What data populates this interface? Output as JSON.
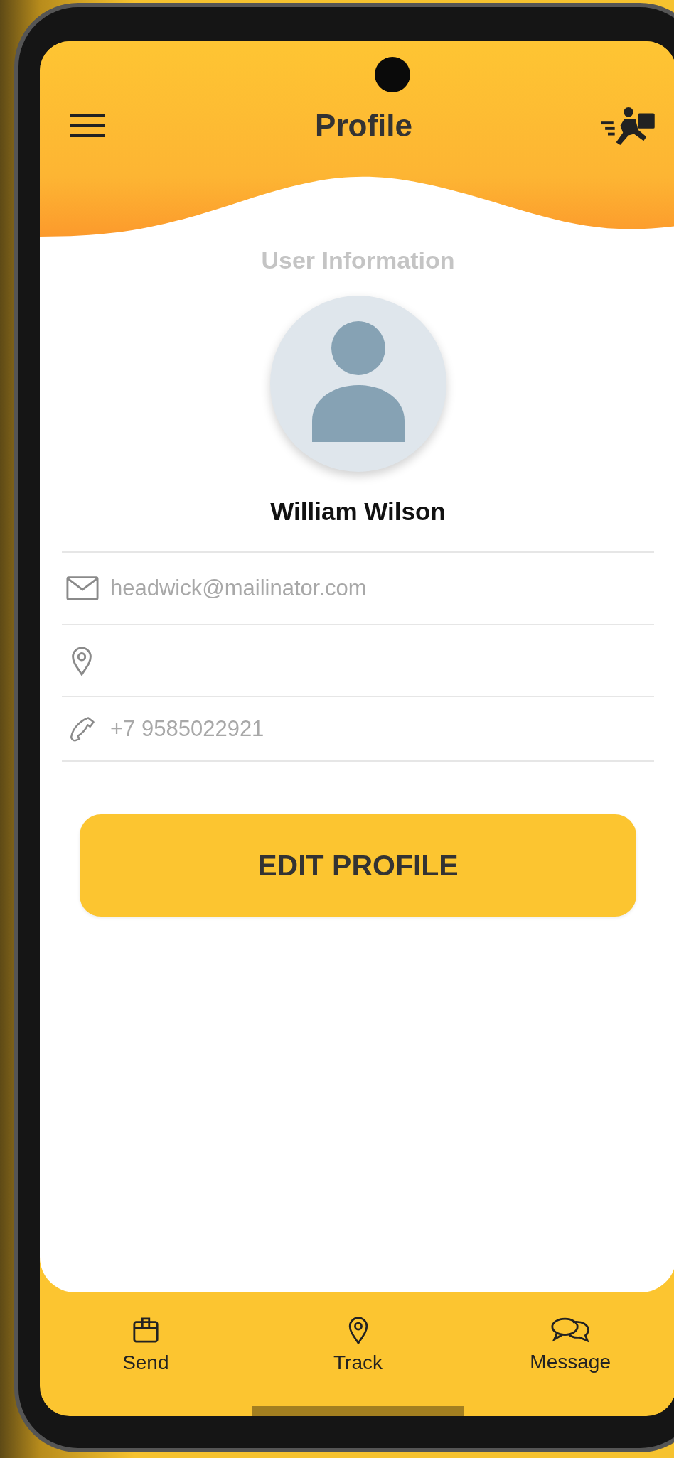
{
  "header": {
    "title": "Profile"
  },
  "section_title": "User Information",
  "user": {
    "name": "William Wilson"
  },
  "fields": [
    {
      "kind": "email",
      "value": "headwick@mailinator.com"
    },
    {
      "kind": "location"
    },
    {
      "kind": "phone",
      "value": "+7 9585022921"
    }
  ],
  "edit_button": "EDIT PROFILE",
  "nav": [
    {
      "kind": "send",
      "label": "Send",
      "selected": false
    },
    {
      "kind": "track",
      "label": "Track",
      "selected": true
    },
    {
      "kind": "message",
      "label": "Message",
      "selected": false
    }
  ]
}
